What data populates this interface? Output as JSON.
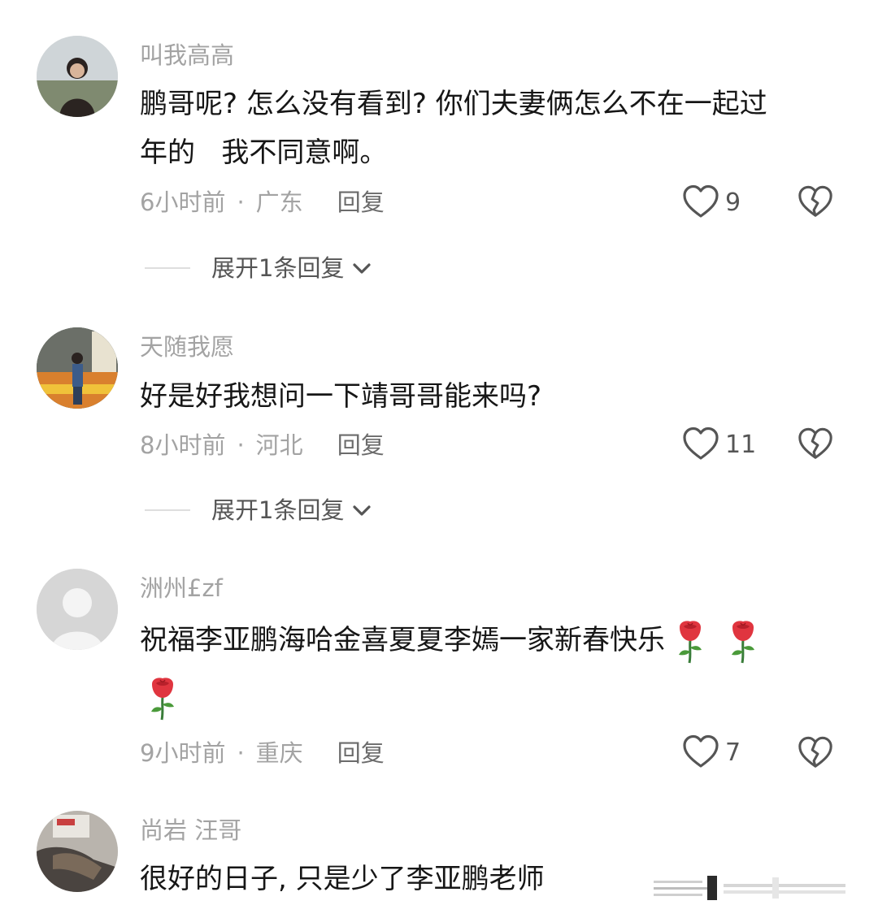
{
  "comments": [
    {
      "username": "叫我高高",
      "text_line1": "鹏哥呢? 怎么没有看到? 你们夫妻俩怎么不在一起过",
      "text_line2": "年的   我不同意啊。",
      "time": "6小时前",
      "location": "广东",
      "reply_label": "回复",
      "likes": "9",
      "expand_label": "展开1条回复"
    },
    {
      "username": "天随我愿",
      "text_line1": "好是好我想问一下靖哥哥能来吗?",
      "time": "8小时前",
      "location": "河北",
      "reply_label": "回复",
      "likes": "11",
      "expand_label": "展开1条回复"
    },
    {
      "username": "洲州£zf",
      "text_line1": "祝福李亚鹏海哈金喜夏夏李嫣一家新春快乐",
      "emoji": "rose",
      "time": "9小时前",
      "location": "重庆",
      "reply_label": "回复",
      "likes": "7"
    },
    {
      "username": "尚岩 汪哥",
      "text_line1": "很好的日子, 只是少了李亚鹏老师"
    }
  ],
  "meta_separator": "·",
  "icons": {
    "like": "heart-outline-icon",
    "dislike": "broken-heart-icon",
    "expand": "chevron-down-icon",
    "emoji": "rose-icon"
  },
  "colors": {
    "text": "#161616",
    "muted": "#a3a3a3",
    "reply": "#6b6b6b",
    "icon": "#555555"
  }
}
